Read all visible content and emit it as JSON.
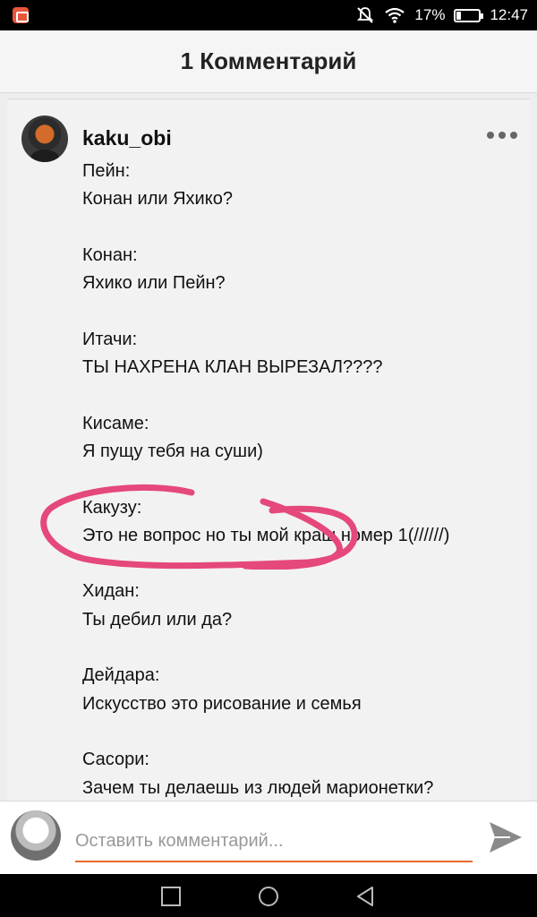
{
  "status_bar": {
    "battery_percent": "17%",
    "time": "12:47",
    "battery_level": 0.17,
    "icons": [
      "app-notification-icon",
      "mute-icon",
      "wifi-icon",
      "battery-icon"
    ]
  },
  "header": {
    "title": "1 Комментарий"
  },
  "comment": {
    "username": "kaku_obi",
    "menu_icon": "more-horizontal-icon",
    "lines": [
      "Пейн:",
      "Конан или Яхико?",
      "",
      "Конан:",
      "Яхико или Пейн?",
      "",
      "Итачи:",
      "ТЫ НАХРЕНА КЛАН ВЫРЕЗАЛ????",
      "",
      "Кисаме:",
      "Я пущу тебя на суши)",
      "",
      "Какузу:",
      "Это не вопрос но ты мой краш номер 1(//////)",
      "",
      "Хидан:",
      "Ты дебил или да?",
      "",
      "Дейдара:",
      "Искусство это рисование и семья",
      "",
      "Сасори:",
      "Зачем ты делаешь из людей марионетки?"
    ]
  },
  "annotation": {
    "color": "#e5487a"
  },
  "input": {
    "placeholder": "Оставить комментарий...",
    "value": "",
    "accent_color": "#e8692d",
    "send_icon": "send-icon"
  },
  "navbar": {
    "icons": [
      "recents-icon",
      "home-icon",
      "back-icon"
    ]
  }
}
